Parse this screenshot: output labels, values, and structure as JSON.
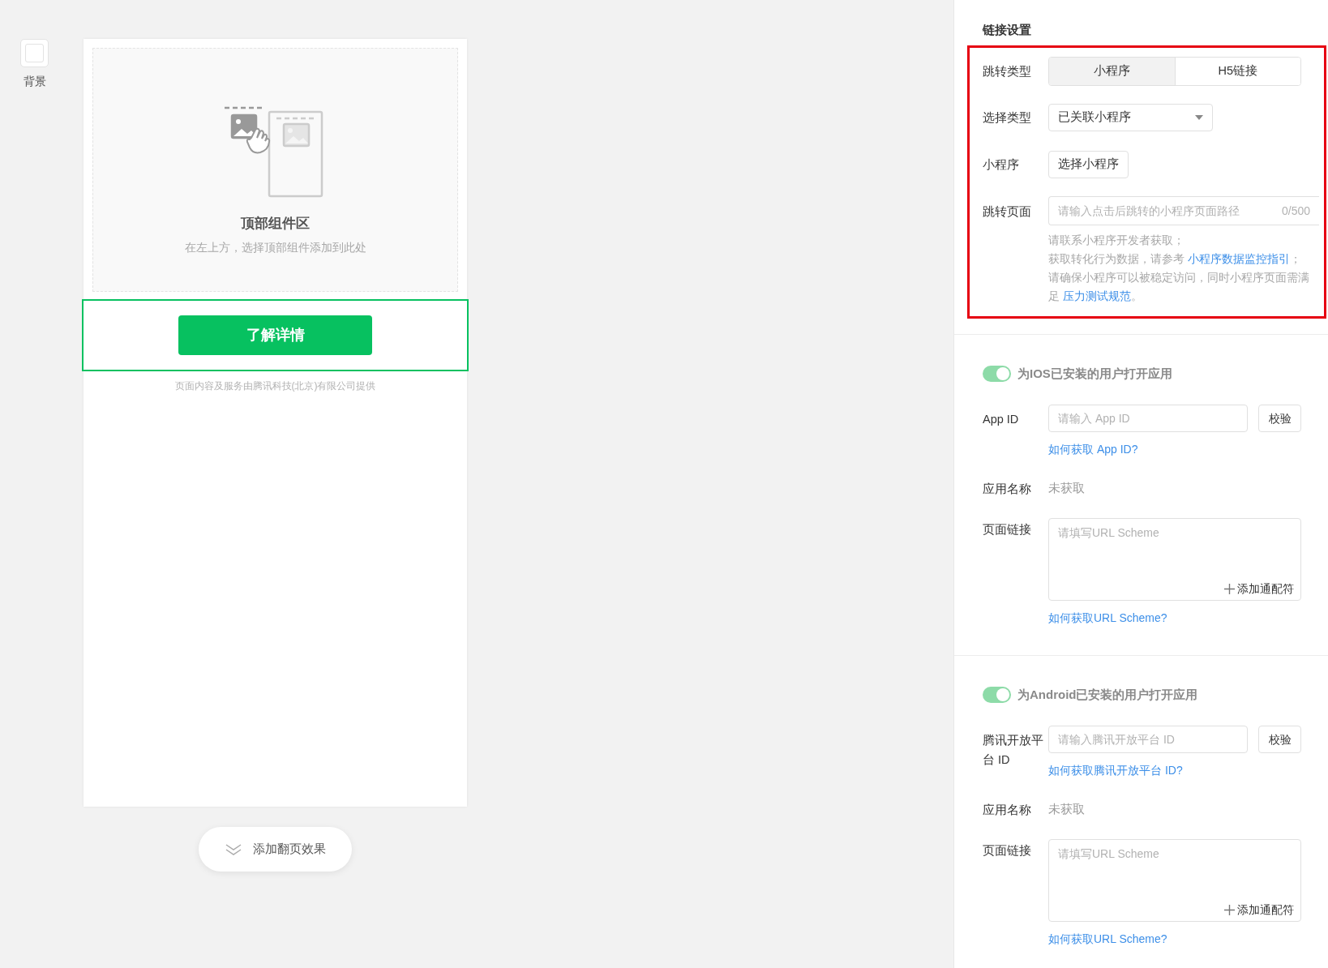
{
  "sidebar": {
    "items": [
      {
        "label": "背景"
      }
    ]
  },
  "canvas": {
    "top_zone": {
      "title": "顶部组件区",
      "hint": "在左上方，选择顶部组件添加到此处"
    },
    "cta_button": {
      "label": "了解详情",
      "selected": true
    },
    "footer": "页面内容及服务由腾讯科技(北京)有限公司提供",
    "page_effect_button": "添加翻页效果"
  },
  "panel": {
    "title": "链接设置",
    "jump_type": {
      "label": "跳转类型",
      "options": [
        {
          "label": "小程序",
          "selected": true
        },
        {
          "label": "H5链接",
          "selected": false
        }
      ]
    },
    "select_type": {
      "label": "选择类型",
      "value": "已关联小程序"
    },
    "mini_program": {
      "label": "小程序",
      "button": "选择小程序"
    },
    "jump_page": {
      "label": "跳转页面",
      "placeholder": "请输入点击后跳转的小程序页面路径",
      "counter": "0/500"
    },
    "help": [
      {
        "text": "请联系小程序开发者获取；"
      },
      {
        "text": "获取转化行为数据，请参考 ",
        "link": "小程序数据监控指引",
        "after": "；"
      },
      {
        "text": "请确保小程序可以被稳定访问，同时小程序页面需满足 ",
        "link": "压力测试规范",
        "after": "。"
      }
    ]
  },
  "app_sections": [
    {
      "on": true,
      "title": "为IOS已安装的用户打开应用",
      "id_label": "App ID",
      "id_placeholder": "请输入 App ID",
      "verify": "校验",
      "id_help": "如何获取 App ID?",
      "name_label": "应用名称",
      "name_value": "未获取",
      "link_label": "页面链接",
      "link_placeholder": "请填写URL Scheme",
      "wildcard": "添加通配符",
      "link_help": "如何获取URL Scheme?"
    },
    {
      "on": true,
      "title": "为Android已安装的用户打开应用",
      "id_label": "腾讯开放平台 ID",
      "id_placeholder": "请输入腾讯开放平台 ID",
      "verify": "校验",
      "id_help": "如何获取腾讯开放平台 ID?",
      "name_label": "应用名称",
      "name_value": "未获取",
      "link_label": "页面链接",
      "link_placeholder": "请填写URL Scheme",
      "wildcard": "添加通配符",
      "link_help": "如何获取URL Scheme?"
    }
  ]
}
